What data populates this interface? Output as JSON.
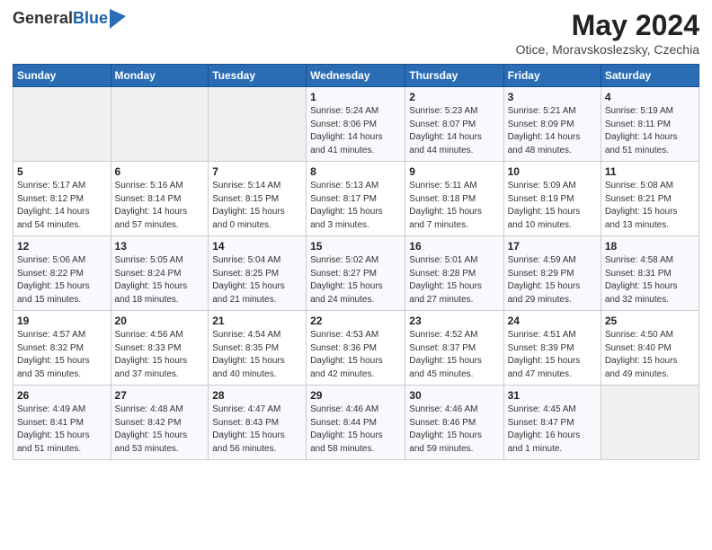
{
  "logo": {
    "general": "General",
    "blue": "Blue"
  },
  "title": "May 2024",
  "subtitle": "Otice, Moravskoslezsky, Czechia",
  "weekdays": [
    "Sunday",
    "Monday",
    "Tuesday",
    "Wednesday",
    "Thursday",
    "Friday",
    "Saturday"
  ],
  "weeks": [
    [
      {
        "day": "",
        "info": ""
      },
      {
        "day": "",
        "info": ""
      },
      {
        "day": "",
        "info": ""
      },
      {
        "day": "1",
        "info": "Sunrise: 5:24 AM\nSunset: 8:06 PM\nDaylight: 14 hours\nand 41 minutes."
      },
      {
        "day": "2",
        "info": "Sunrise: 5:23 AM\nSunset: 8:07 PM\nDaylight: 14 hours\nand 44 minutes."
      },
      {
        "day": "3",
        "info": "Sunrise: 5:21 AM\nSunset: 8:09 PM\nDaylight: 14 hours\nand 48 minutes."
      },
      {
        "day": "4",
        "info": "Sunrise: 5:19 AM\nSunset: 8:11 PM\nDaylight: 14 hours\nand 51 minutes."
      }
    ],
    [
      {
        "day": "5",
        "info": "Sunrise: 5:17 AM\nSunset: 8:12 PM\nDaylight: 14 hours\nand 54 minutes."
      },
      {
        "day": "6",
        "info": "Sunrise: 5:16 AM\nSunset: 8:14 PM\nDaylight: 14 hours\nand 57 minutes."
      },
      {
        "day": "7",
        "info": "Sunrise: 5:14 AM\nSunset: 8:15 PM\nDaylight: 15 hours\nand 0 minutes."
      },
      {
        "day": "8",
        "info": "Sunrise: 5:13 AM\nSunset: 8:17 PM\nDaylight: 15 hours\nand 3 minutes."
      },
      {
        "day": "9",
        "info": "Sunrise: 5:11 AM\nSunset: 8:18 PM\nDaylight: 15 hours\nand 7 minutes."
      },
      {
        "day": "10",
        "info": "Sunrise: 5:09 AM\nSunset: 8:19 PM\nDaylight: 15 hours\nand 10 minutes."
      },
      {
        "day": "11",
        "info": "Sunrise: 5:08 AM\nSunset: 8:21 PM\nDaylight: 15 hours\nand 13 minutes."
      }
    ],
    [
      {
        "day": "12",
        "info": "Sunrise: 5:06 AM\nSunset: 8:22 PM\nDaylight: 15 hours\nand 15 minutes."
      },
      {
        "day": "13",
        "info": "Sunrise: 5:05 AM\nSunset: 8:24 PM\nDaylight: 15 hours\nand 18 minutes."
      },
      {
        "day": "14",
        "info": "Sunrise: 5:04 AM\nSunset: 8:25 PM\nDaylight: 15 hours\nand 21 minutes."
      },
      {
        "day": "15",
        "info": "Sunrise: 5:02 AM\nSunset: 8:27 PM\nDaylight: 15 hours\nand 24 minutes."
      },
      {
        "day": "16",
        "info": "Sunrise: 5:01 AM\nSunset: 8:28 PM\nDaylight: 15 hours\nand 27 minutes."
      },
      {
        "day": "17",
        "info": "Sunrise: 4:59 AM\nSunset: 8:29 PM\nDaylight: 15 hours\nand 29 minutes."
      },
      {
        "day": "18",
        "info": "Sunrise: 4:58 AM\nSunset: 8:31 PM\nDaylight: 15 hours\nand 32 minutes."
      }
    ],
    [
      {
        "day": "19",
        "info": "Sunrise: 4:57 AM\nSunset: 8:32 PM\nDaylight: 15 hours\nand 35 minutes."
      },
      {
        "day": "20",
        "info": "Sunrise: 4:56 AM\nSunset: 8:33 PM\nDaylight: 15 hours\nand 37 minutes."
      },
      {
        "day": "21",
        "info": "Sunrise: 4:54 AM\nSunset: 8:35 PM\nDaylight: 15 hours\nand 40 minutes."
      },
      {
        "day": "22",
        "info": "Sunrise: 4:53 AM\nSunset: 8:36 PM\nDaylight: 15 hours\nand 42 minutes."
      },
      {
        "day": "23",
        "info": "Sunrise: 4:52 AM\nSunset: 8:37 PM\nDaylight: 15 hours\nand 45 minutes."
      },
      {
        "day": "24",
        "info": "Sunrise: 4:51 AM\nSunset: 8:39 PM\nDaylight: 15 hours\nand 47 minutes."
      },
      {
        "day": "25",
        "info": "Sunrise: 4:50 AM\nSunset: 8:40 PM\nDaylight: 15 hours\nand 49 minutes."
      }
    ],
    [
      {
        "day": "26",
        "info": "Sunrise: 4:49 AM\nSunset: 8:41 PM\nDaylight: 15 hours\nand 51 minutes."
      },
      {
        "day": "27",
        "info": "Sunrise: 4:48 AM\nSunset: 8:42 PM\nDaylight: 15 hours\nand 53 minutes."
      },
      {
        "day": "28",
        "info": "Sunrise: 4:47 AM\nSunset: 8:43 PM\nDaylight: 15 hours\nand 56 minutes."
      },
      {
        "day": "29",
        "info": "Sunrise: 4:46 AM\nSunset: 8:44 PM\nDaylight: 15 hours\nand 58 minutes."
      },
      {
        "day": "30",
        "info": "Sunrise: 4:46 AM\nSunset: 8:46 PM\nDaylight: 15 hours\nand 59 minutes."
      },
      {
        "day": "31",
        "info": "Sunrise: 4:45 AM\nSunset: 8:47 PM\nDaylight: 16 hours\nand 1 minute."
      },
      {
        "day": "",
        "info": ""
      }
    ]
  ]
}
